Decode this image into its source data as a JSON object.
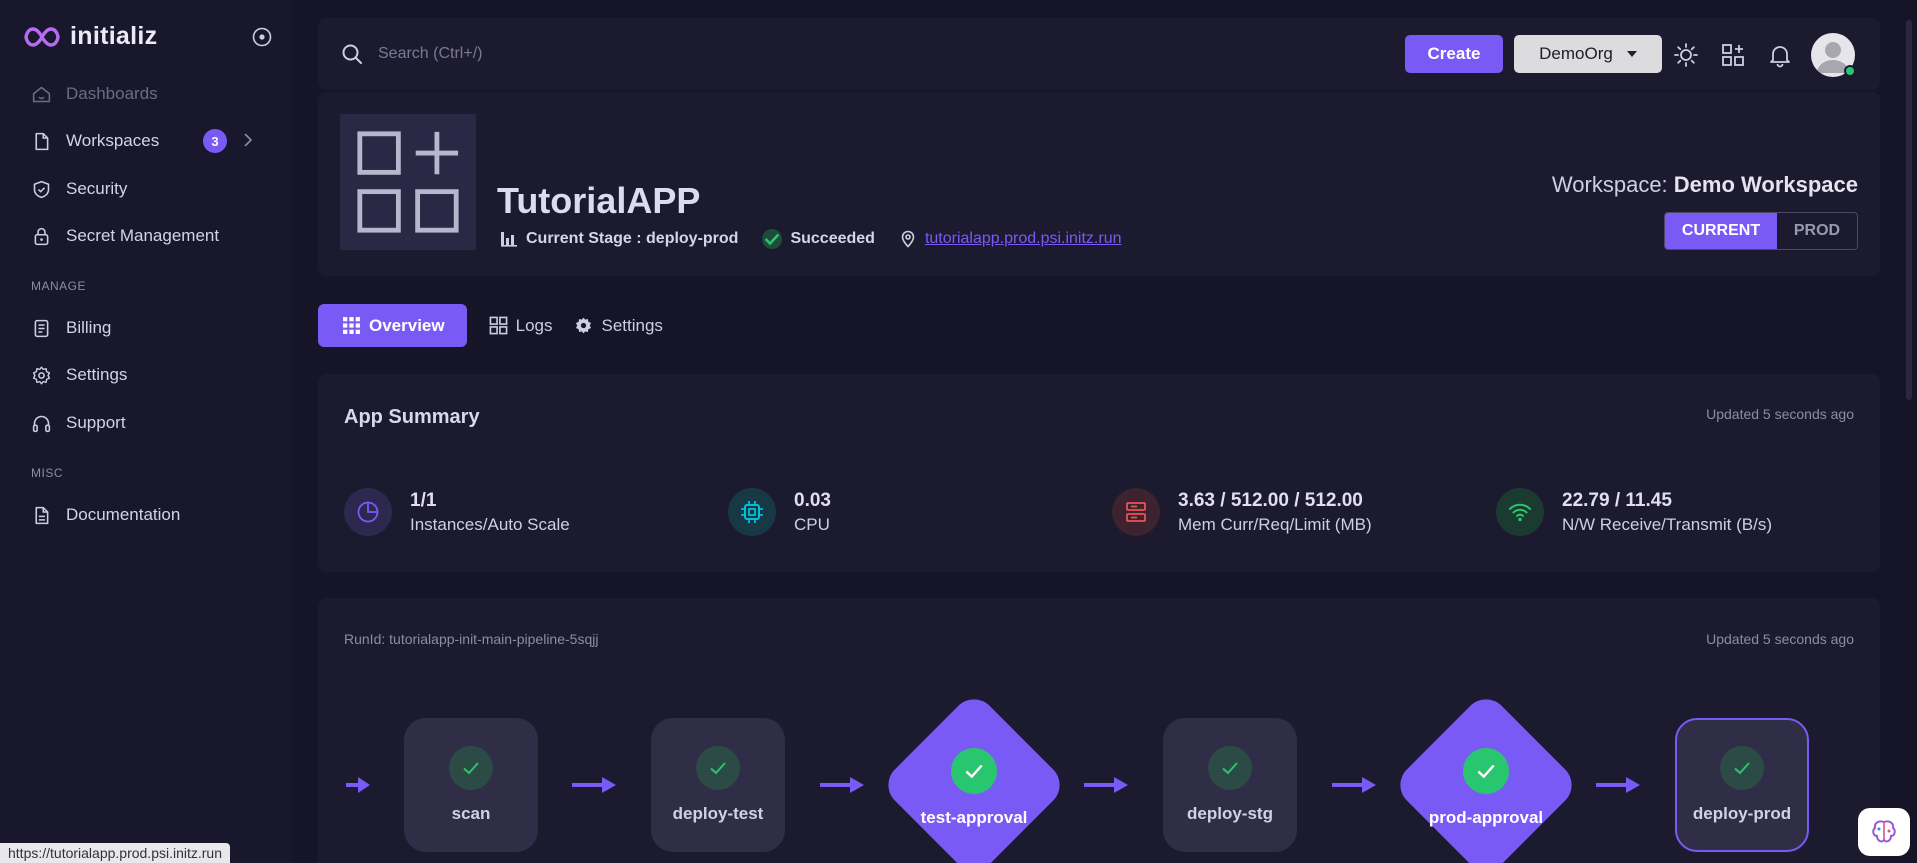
{
  "brand": {
    "name": "initializ"
  },
  "sidebar": {
    "items": [
      {
        "label": "Dashboards"
      },
      {
        "label": "Workspaces",
        "badge": "3"
      },
      {
        "label": "Security"
      },
      {
        "label": "Secret Management"
      }
    ],
    "manage_label": "MANAGE",
    "manage_items": [
      {
        "label": "Billing"
      },
      {
        "label": "Settings"
      },
      {
        "label": "Support"
      }
    ],
    "misc_label": "MISC",
    "misc_items": [
      {
        "label": "Documentation"
      }
    ]
  },
  "topbar": {
    "search_placeholder": "Search (Ctrl+/)",
    "create_label": "Create",
    "org_label": "DemoOrg"
  },
  "app": {
    "title": "TutorialAPP",
    "stage": "Current Stage : deploy-prod",
    "status": "Succeeded",
    "url": "tutorialapp.prod.psi.initz.run",
    "workspace_prefix": "Workspace: ",
    "workspace_name": "Demo Workspace",
    "toggle_current": "CURRENT",
    "toggle_prod": "PROD"
  },
  "tabs": [
    {
      "label": "Overview"
    },
    {
      "label": "Logs"
    },
    {
      "label": "Settings"
    }
  ],
  "summary": {
    "title": "App Summary",
    "updated": "Updated 5 seconds ago",
    "stats": [
      {
        "value": "1/1",
        "label": "Instances/Auto Scale",
        "color": "#7a5af5"
      },
      {
        "value": "0.03",
        "label": "CPU",
        "color": "#00cfe8"
      },
      {
        "value": "3.63 / 512.00 / 512.00",
        "label": "Mem Curr/Req/Limit (MB)",
        "color": "#ea5455"
      },
      {
        "value": "22.79 / 11.45",
        "label": "N/W Receive/Transmit (B/s)",
        "color": "#28c76f"
      }
    ]
  },
  "pipeline": {
    "run_id": "RunId: tutorialapp-init-main-pipeline-5sqjj",
    "updated": "Updated 5 seconds ago",
    "stages": [
      {
        "label": "scan",
        "kind": "task"
      },
      {
        "label": "deploy-test",
        "kind": "task"
      },
      {
        "label": "test-approval",
        "kind": "approval"
      },
      {
        "label": "deploy-stg",
        "kind": "task"
      },
      {
        "label": "prod-approval",
        "kind": "approval"
      },
      {
        "label": "deploy-prod",
        "kind": "task-current"
      }
    ]
  },
  "status_bar": {
    "url": "https://tutorialapp.prod.psi.initz.run"
  },
  "colors": {
    "accent": "#7a5af5",
    "bg": "#161427",
    "card": "#1c1a2e",
    "success": "#28c76f"
  }
}
